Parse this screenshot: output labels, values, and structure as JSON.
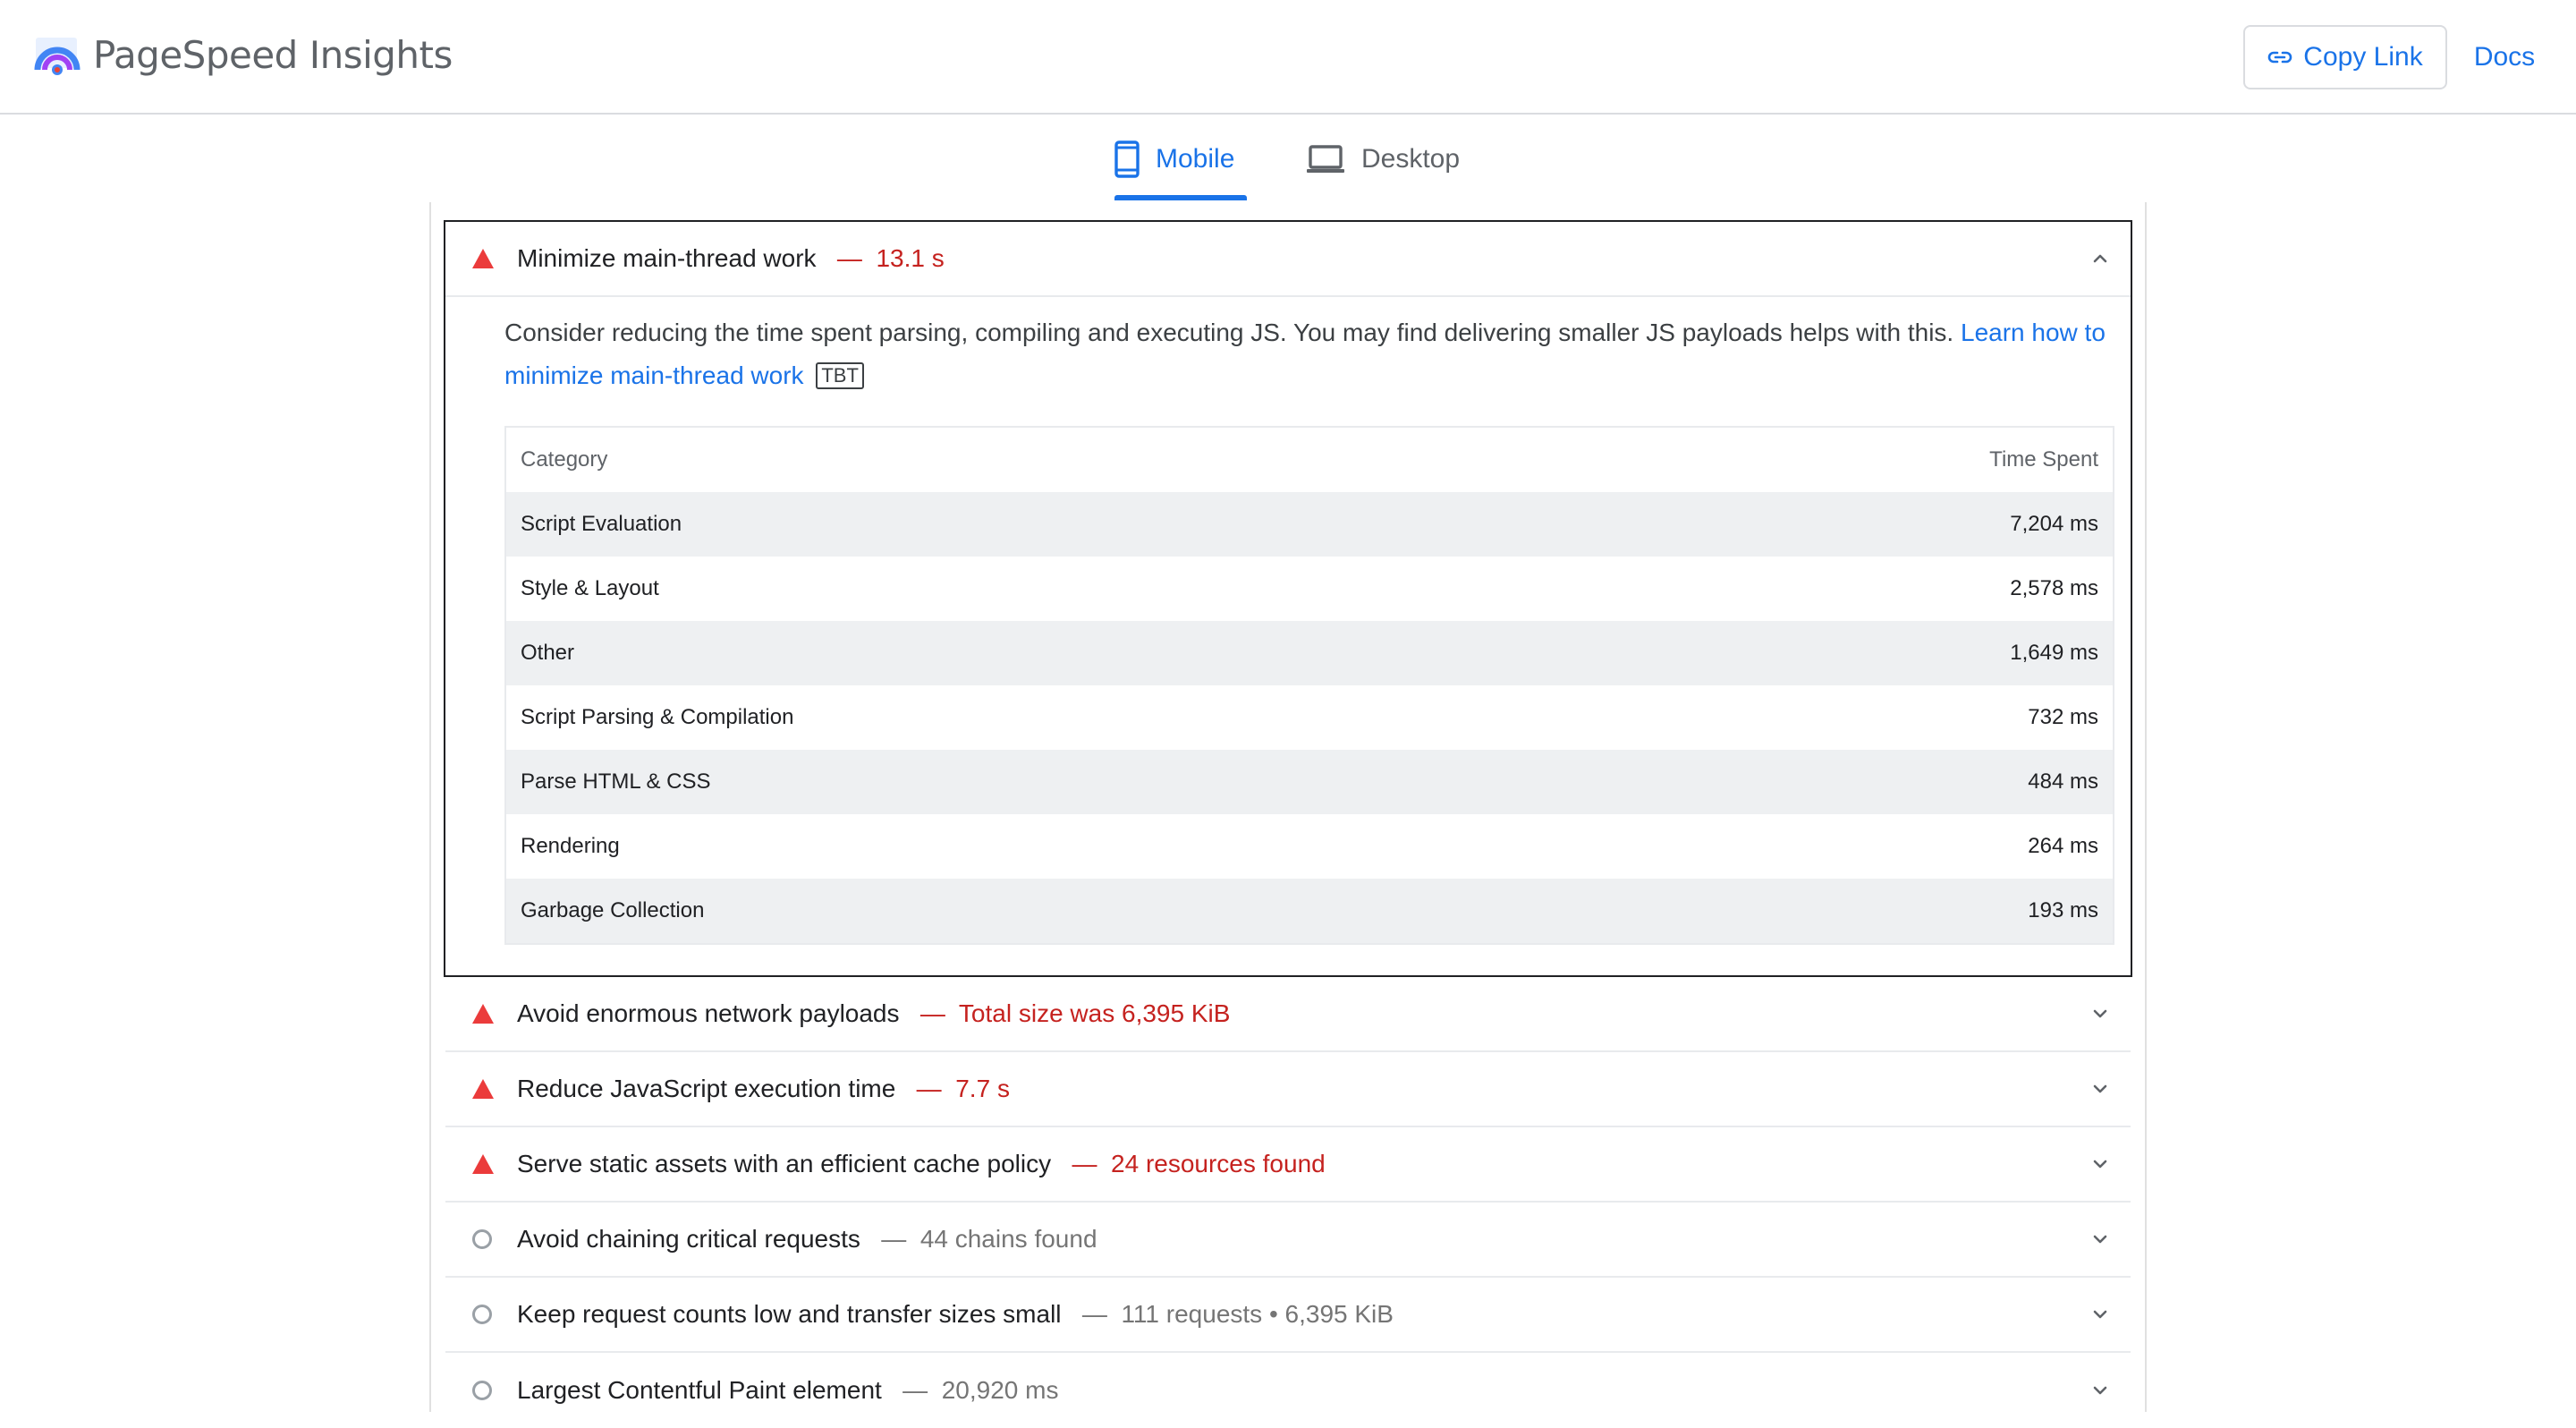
{
  "header": {
    "app_title": "PageSpeed Insights",
    "logo_icon": "pagespeed-logo-icon",
    "copy_link_label": "Copy Link",
    "copy_link_icon": "link-icon",
    "docs_label": "Docs"
  },
  "tabs": [
    {
      "label": "Mobile",
      "icon": "phone-icon",
      "selected": true
    },
    {
      "label": "Desktop",
      "icon": "laptop-icon",
      "selected": false
    }
  ],
  "expanded_audit": {
    "title": "Minimize main-thread work",
    "separator": "—",
    "display_value": "13.1 s",
    "status": "fail",
    "description": "Consider reducing the time spent parsing, compiling and executing JS. You may find delivering smaller JS payloads helps with this.",
    "link_text": "Learn how to minimize main-thread work",
    "badge": "TBT",
    "table": {
      "col_category": "Category",
      "col_time": "Time Spent",
      "rows": [
        {
          "category": "Script Evaluation",
          "time": "7,204 ms"
        },
        {
          "category": "Style & Layout",
          "time": "2,578 ms"
        },
        {
          "category": "Other",
          "time": "1,649 ms"
        },
        {
          "category": "Script Parsing & Compilation",
          "time": "732 ms"
        },
        {
          "category": "Parse HTML & CSS",
          "time": "484 ms"
        },
        {
          "category": "Rendering",
          "time": "264 ms"
        },
        {
          "category": "Garbage Collection",
          "time": "193 ms"
        }
      ]
    }
  },
  "audits": [
    {
      "title": "Avoid enormous network payloads",
      "separator": "—",
      "display_value": "Total size was 6,395 KiB",
      "status": "fail"
    },
    {
      "title": "Reduce JavaScript execution time",
      "separator": "—",
      "display_value": "7.7 s",
      "status": "fail"
    },
    {
      "title": "Serve static assets with an efficient cache policy",
      "separator": "—",
      "display_value": "24 resources found",
      "status": "fail"
    },
    {
      "title": "Avoid chaining critical requests",
      "separator": "—",
      "display_value": "44 chains found",
      "status": "informative"
    },
    {
      "title": "Keep request counts low and transfer sizes small",
      "separator": "—",
      "display_value": "111 requests • 6,395 KiB",
      "status": "informative"
    },
    {
      "title": "Largest Contentful Paint element",
      "separator": "—",
      "display_value": "20,920 ms",
      "status": "informative"
    }
  ],
  "colors": {
    "accent": "#1a73e8",
    "fail": "#eb3b3b",
    "fail_text": "#c5221f",
    "informative": "#9aa0a6",
    "row_alt": "#eef0f2"
  }
}
